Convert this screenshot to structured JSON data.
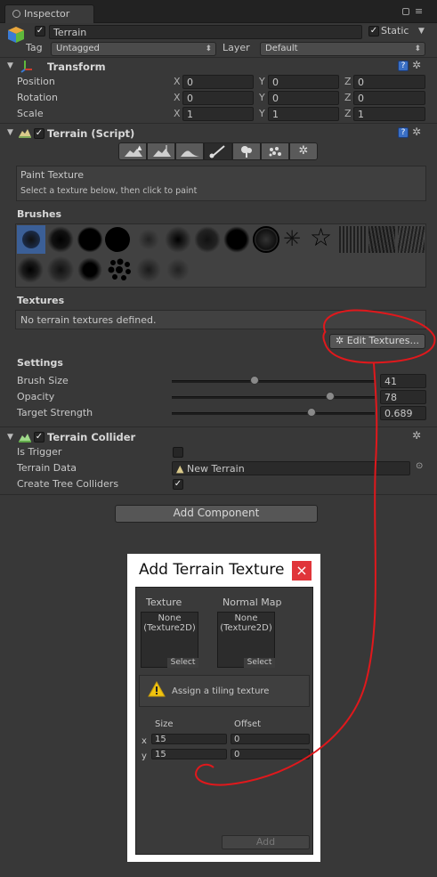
{
  "tab": {
    "title": "Inspector"
  },
  "object": {
    "name": "Terrain",
    "static_label": "Static",
    "tag_label": "Tag",
    "tag_value": "Untagged",
    "layer_label": "Layer",
    "layer_value": "Default"
  },
  "transform": {
    "title": "Transform",
    "rows": [
      {
        "label": "Position",
        "x": "0",
        "y": "0",
        "z": "0"
      },
      {
        "label": "Rotation",
        "x": "0",
        "y": "0",
        "z": "0"
      },
      {
        "label": "Scale",
        "x": "1",
        "y": "1",
        "z": "1"
      }
    ],
    "axes": [
      "X",
      "Y",
      "Z"
    ]
  },
  "terrain_script": {
    "title": "Terrain (Script)",
    "tools": [
      "raise-lower-terrain-icon",
      "paint-height-icon",
      "smooth-height-icon",
      "paint-texture-icon",
      "place-trees-icon",
      "paint-details-icon",
      "terrain-settings-icon"
    ],
    "help_title": "Paint Texture",
    "help_text": "Select a texture below, then click to paint",
    "brushes_label": "Brushes",
    "textures_label": "Textures",
    "no_textures": "No terrain textures defined.",
    "edit_textures": "Edit Textures...",
    "settings_label": "Settings",
    "settings": [
      {
        "label": "Brush Size",
        "value": "41",
        "fraction": 0.41
      },
      {
        "label": "Opacity",
        "value": "78",
        "fraction": 0.78
      },
      {
        "label": "Target Strength",
        "value": "0.689",
        "fraction": 0.689
      }
    ]
  },
  "collider": {
    "title": "Terrain Collider",
    "is_trigger_label": "Is Trigger",
    "terrain_data_label": "Terrain Data",
    "terrain_data_value": "New Terrain",
    "tree_colliders_label": "Create Tree Colliders"
  },
  "add_component": "Add Component",
  "dialog": {
    "title": "Add Terrain Texture",
    "close": "×",
    "texture_label": "Texture",
    "normal_label": "Normal Map",
    "none_line1": "None",
    "none_line2": "(Texture2D)",
    "select": "Select",
    "warning": "Assign a tiling texture",
    "size_label": "Size",
    "offset_label": "Offset",
    "x_label": "x",
    "y_label": "y",
    "size_x": "15",
    "size_y": "15",
    "offset_x": "0",
    "offset_y": "0",
    "add": "Add"
  },
  "colors": {
    "annotation": "#e0181c",
    "dialog_close": "#e0353a"
  }
}
